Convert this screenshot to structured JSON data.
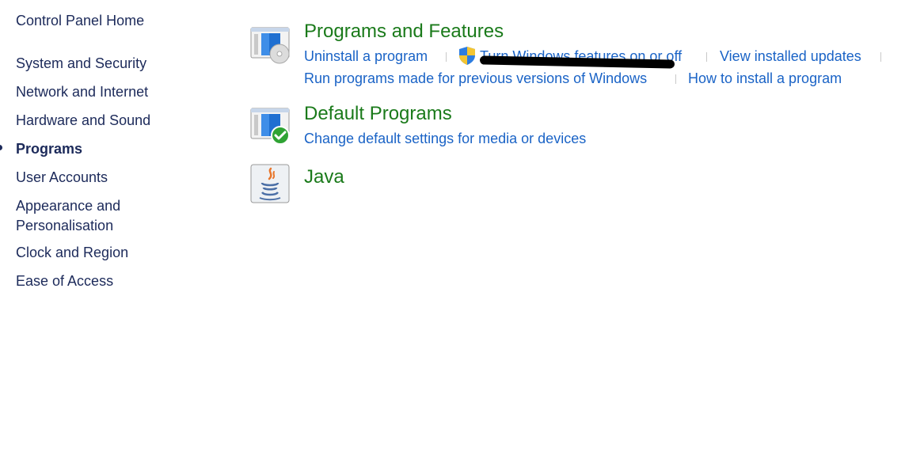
{
  "sidebar": {
    "home": "Control Panel Home",
    "items": [
      {
        "label": "System and Security"
      },
      {
        "label": "Network and Internet"
      },
      {
        "label": "Hardware and Sound"
      },
      {
        "label": "Programs"
      },
      {
        "label": "User Accounts"
      },
      {
        "label": "Appearance and Personalisation"
      },
      {
        "label": "Clock and Region"
      },
      {
        "label": "Ease of Access"
      }
    ]
  },
  "main": {
    "programs_features": {
      "title": "Programs and Features",
      "links": [
        "Uninstall a program",
        "Turn Windows features on or off",
        "View installed updates",
        "Run programs made for previous versions of Windows",
        "How to install a program"
      ]
    },
    "default_programs": {
      "title": "Default Programs",
      "links": [
        "Change default settings for media or devices"
      ]
    },
    "java": {
      "title": "Java"
    }
  },
  "colors": {
    "category_title": "#1a7a1a",
    "link": "#1a63c6",
    "sidebar_text": "#1c2a5a"
  },
  "icons": [
    "programs-features-icon",
    "uac-shield-icon",
    "default-programs-icon",
    "java-icon"
  ]
}
